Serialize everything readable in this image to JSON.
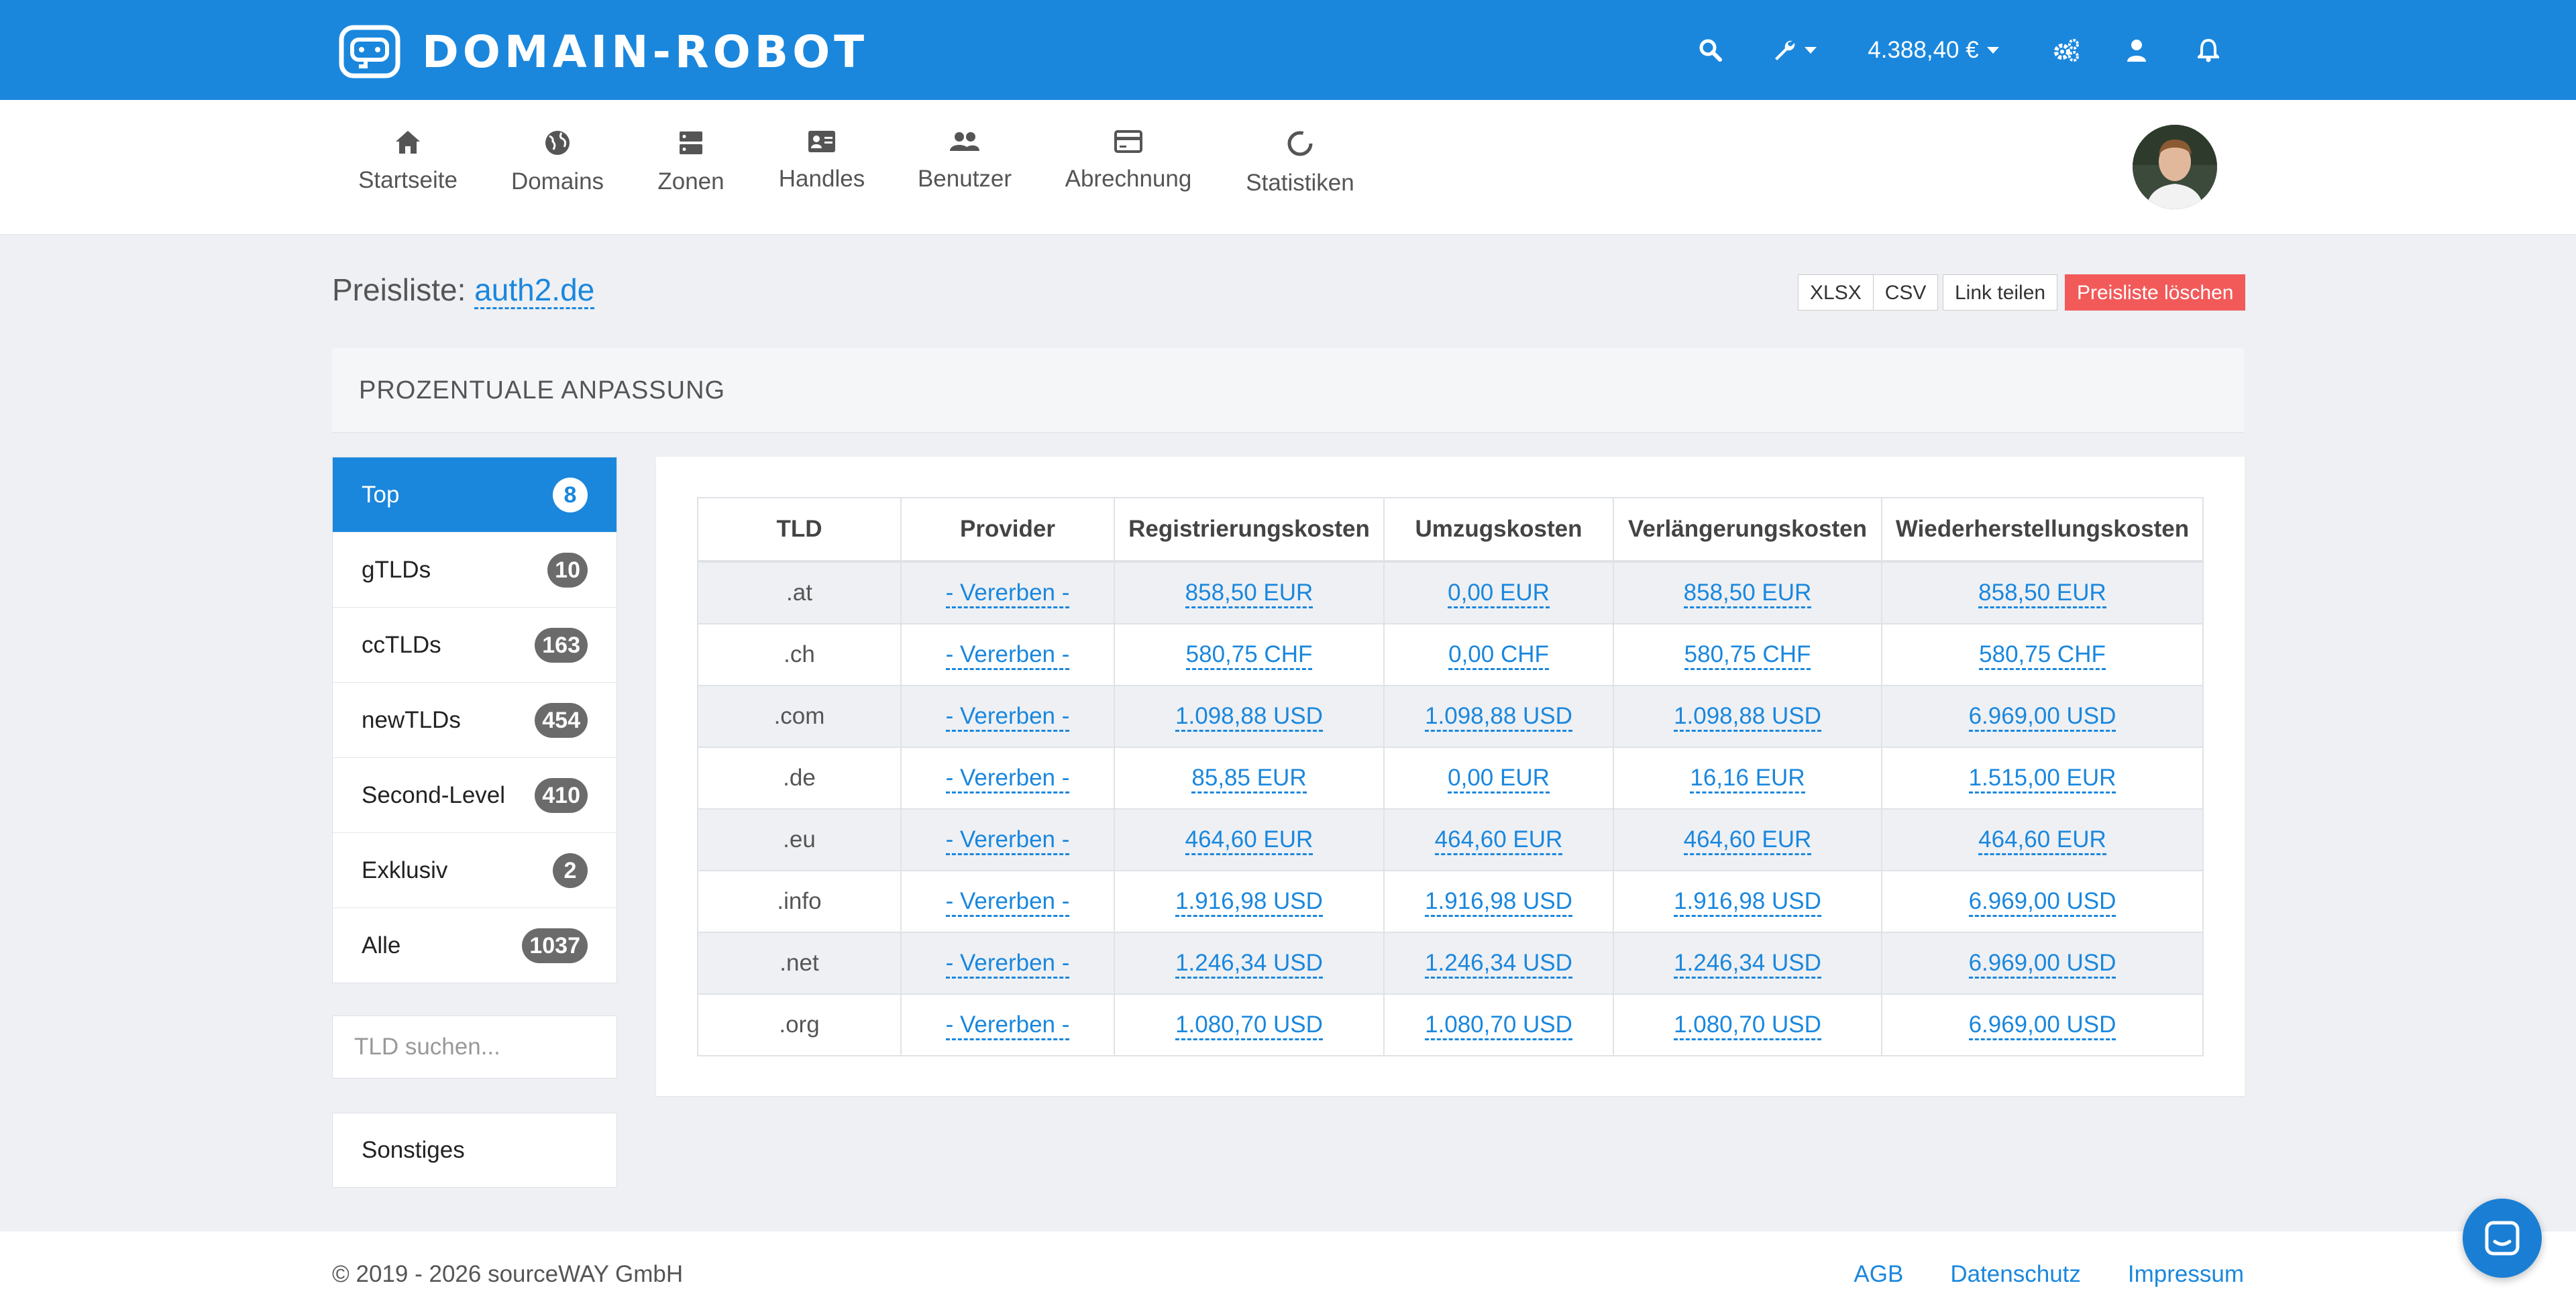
{
  "app": {
    "logo_text": "DOMAIN-ROBOT"
  },
  "topbar": {
    "balance": "4.388,40 €"
  },
  "nav": {
    "items": [
      {
        "label": "Startseite",
        "icon": "home-icon"
      },
      {
        "label": "Domains",
        "icon": "globe-icon"
      },
      {
        "label": "Zonen",
        "icon": "server-icon"
      },
      {
        "label": "Handles",
        "icon": "id-card-icon"
      },
      {
        "label": "Benutzer",
        "icon": "users-icon"
      },
      {
        "label": "Abrechnung",
        "icon": "credit-card-icon"
      },
      {
        "label": "Statistiken",
        "icon": "chart-circle-icon"
      }
    ]
  },
  "page": {
    "title_prefix": "Preisliste:",
    "title_link": "auth2.de",
    "buttons": {
      "xlsx": "XLSX",
      "csv": "CSV",
      "share": "Link teilen",
      "delete": "Preisliste löschen"
    },
    "section_header": "PROZENTUALE ANPASSUNG"
  },
  "sidebar": {
    "items": [
      {
        "label": "Top",
        "count": "8",
        "active": true
      },
      {
        "label": "gTLDs",
        "count": "10"
      },
      {
        "label": "ccTLDs",
        "count": "163"
      },
      {
        "label": "newTLDs",
        "count": "454"
      },
      {
        "label": "Second-Level",
        "count": "410"
      },
      {
        "label": "Exklusiv",
        "count": "2"
      },
      {
        "label": "Alle",
        "count": "1037"
      }
    ],
    "search_placeholder": "TLD suchen...",
    "misc": "Sonstiges"
  },
  "table": {
    "headers": [
      "TLD",
      "Provider",
      "Registrierungskosten",
      "Umzugskosten",
      "Verlängerungskosten",
      "Wiederherstellungskosten"
    ],
    "rows": [
      [
        ".at",
        "- Vererben -",
        "858,50 EUR",
        "0,00 EUR",
        "858,50 EUR",
        "858,50 EUR"
      ],
      [
        ".ch",
        "- Vererben -",
        "580,75 CHF",
        "0,00 CHF",
        "580,75 CHF",
        "580,75 CHF"
      ],
      [
        ".com",
        "- Vererben -",
        "1.098,88 USD",
        "1.098,88 USD",
        "1.098,88 USD",
        "6.969,00 USD"
      ],
      [
        ".de",
        "- Vererben -",
        "85,85 EUR",
        "0,00 EUR",
        "16,16 EUR",
        "1.515,00 EUR"
      ],
      [
        ".eu",
        "- Vererben -",
        "464,60 EUR",
        "464,60 EUR",
        "464,60 EUR",
        "464,60 EUR"
      ],
      [
        ".info",
        "- Vererben -",
        "1.916,98 USD",
        "1.916,98 USD",
        "1.916,98 USD",
        "6.969,00 USD"
      ],
      [
        ".net",
        "- Vererben -",
        "1.246,34 USD",
        "1.246,34 USD",
        "1.246,34 USD",
        "6.969,00 USD"
      ],
      [
        ".org",
        "- Vererben -",
        "1.080,70 USD",
        "1.080,70 USD",
        "1.080,70 USD",
        "6.969,00 USD"
      ]
    ]
  },
  "footer": {
    "copyright": "© 2019 - 2026 sourceWAY GmbH",
    "links": [
      "AGB",
      "Datenschutz",
      "Impressum"
    ]
  },
  "colors": {
    "brand": "#1a87dd",
    "danger": "#f25a5a",
    "background": "#eef0f4"
  }
}
